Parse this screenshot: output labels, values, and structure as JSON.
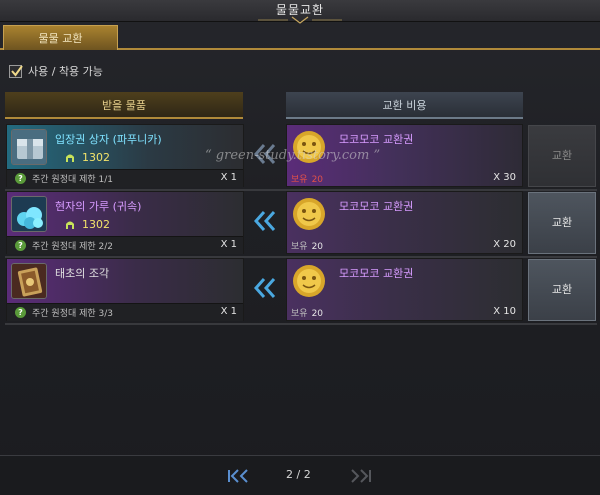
{
  "window": {
    "title": "물물교환"
  },
  "tabs": [
    {
      "label": "물물 교환"
    }
  ],
  "filter": {
    "label": "사용 / 착용 가능",
    "checked": true
  },
  "columns": {
    "receive": "받을 물품",
    "cost": "교환 비용"
  },
  "watermark": "green-study.tistory.com",
  "rows": [
    {
      "item": {
        "name": "입장권 상자 (파푸니카)",
        "power": "1302",
        "limit_label": "주간 원정대 제한 1/1",
        "qty": "X 1"
      },
      "cost": {
        "name": "모코모코 교환권",
        "owned_label": "보유",
        "owned": "20",
        "qty": "X 30"
      },
      "button": {
        "label": "교환",
        "enabled": false
      }
    },
    {
      "item": {
        "name": "현자의 가루 (귀속)",
        "power": "1302",
        "limit_label": "주간 원정대 제한 2/2",
        "qty": "X 1"
      },
      "cost": {
        "name": "모코모코 교환권",
        "owned_label": "보유",
        "owned": "20",
        "qty": "X 20"
      },
      "button": {
        "label": "교환",
        "enabled": true
      }
    },
    {
      "item": {
        "name": "태초의 조각",
        "limit_label": "주간 원정대 제한 3/3",
        "qty": "X 1"
      },
      "cost": {
        "name": "모코모코 교환권",
        "owned_label": "보유",
        "owned": "20",
        "qty": "X 10"
      },
      "button": {
        "label": "교환",
        "enabled": true
      }
    }
  ],
  "pagination": {
    "current": "2 / 2"
  },
  "colors": {
    "gold_accent": "#b08a3a",
    "insufficient": "#e0504a",
    "sufficient": "#e6e6e6",
    "power": "#f2e36a",
    "rare_cyan": "#7fe2ff",
    "epic_purple": "#d79bff"
  },
  "icons": {
    "row1_item": "ticket-box-icon",
    "row2_item": "crystal-dust-icon",
    "row3_item": "primal-fragment-icon",
    "cost": "mokomoko-coin-icon",
    "power": "helmet-icon",
    "arrow": "double-chevron-left-icon"
  }
}
